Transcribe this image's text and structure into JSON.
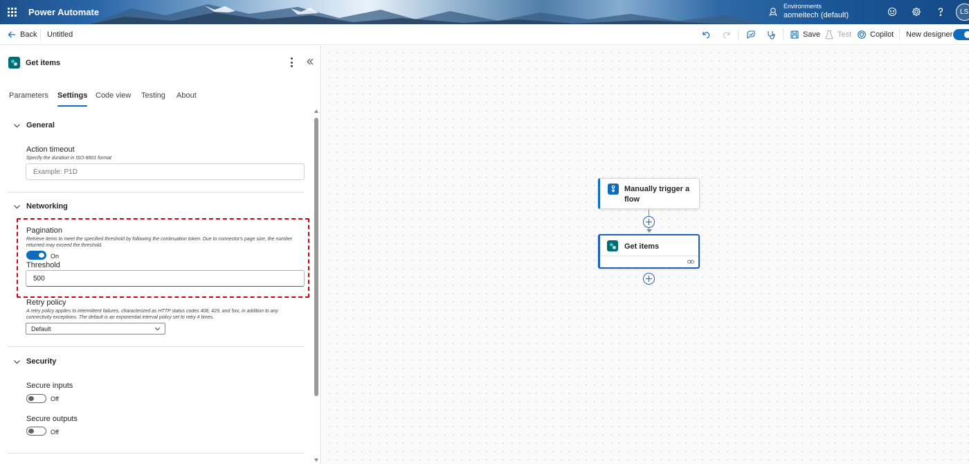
{
  "header": {
    "app_title": "Power Automate",
    "env_label": "Environments",
    "env_name": "aomeitech (default)",
    "avatar_initials": "LS"
  },
  "command_bar": {
    "back_label": "Back",
    "flow_name": "Untitled",
    "save_label": "Save",
    "test_label": "Test",
    "copilot_label": "Copilot",
    "new_designer_label": "New designer",
    "new_designer_on": true
  },
  "panel": {
    "title": "Get items",
    "tabs": [
      {
        "label": "Parameters",
        "active": false
      },
      {
        "label": "Settings",
        "active": true
      },
      {
        "label": "Code view",
        "active": false
      },
      {
        "label": "Testing",
        "active": false
      },
      {
        "label": "About",
        "active": false
      }
    ],
    "general": {
      "heading": "General",
      "action_timeout_label": "Action timeout",
      "action_timeout_desc": "Specify the duration in ISO-8601 format",
      "action_timeout_placeholder": "Example: P1D"
    },
    "networking": {
      "heading": "Networking",
      "pagination_label": "Pagination",
      "pagination_desc": "Retrieve items to meet the specified threshold by following the continuation token. Due to connector's page size, the number returned may exceed the threshold.",
      "pagination_state": "On",
      "threshold_label": "Threshold",
      "threshold_value": "500",
      "retry_label": "Retry policy",
      "retry_desc": "A retry policy applies to intermittent failures, characterized as HTTP status codes 408, 429, and 5xx, in addition to any connectivity exceptions. The default is an exponential interval policy set to retry 4 times.",
      "retry_value": "Default"
    },
    "security": {
      "heading": "Security",
      "secure_inputs_label": "Secure inputs",
      "secure_inputs_state": "Off",
      "secure_outputs_label": "Secure outputs",
      "secure_outputs_state": "Off"
    }
  },
  "canvas": {
    "trigger_card_title": "Manually trigger a flow",
    "action_card_title": "Get items"
  },
  "colors": {
    "accent": "#0f6cbd",
    "highlight_border": "#d2000a",
    "sharepoint": "#036c70"
  }
}
